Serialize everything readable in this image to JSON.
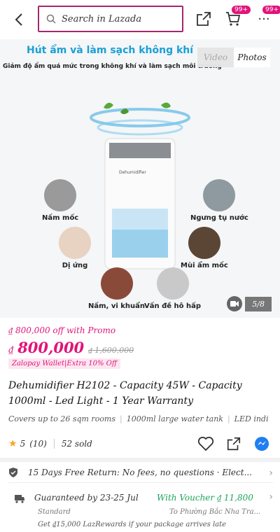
{
  "header": {
    "search_placeholder": "Search in Lazada",
    "cart_badge": "99+",
    "more_badge": "99+"
  },
  "gallery": {
    "banner_title": "Hút ẩm và làm sạch không khí",
    "banner_subtitle": "Giảm độ ẩm quá mức trong không khí và làm sạch môi trường",
    "media_tabs": [
      "Video",
      "Photos"
    ],
    "active_tab": "Photos",
    "features": [
      {
        "label": "Nấm mốc",
        "color": "#9a9a9a"
      },
      {
        "label": "Ngưng tụ nước",
        "color": "#8f9aa0"
      },
      {
        "label": "Dị ứng",
        "color": "#e8d2c2"
      },
      {
        "label": "Mùi ẩm mốc",
        "color": "#5b4636"
      },
      {
        "label": "Nấm, vi khuẩn",
        "color": "#8a4a3a"
      },
      {
        "label": "Vấn đề hô hấp",
        "color": "#c9c9c9"
      }
    ],
    "image_counter": "5/8"
  },
  "pricing": {
    "promo_text": "₫ 800,000 off with Promo",
    "currency": "₫",
    "price": "800,000",
    "original_price": "₫ 1,600,000",
    "wallet_tag": "Zalopay Wallet|Extra 10% Off"
  },
  "product": {
    "title": "Dehumidifier H2102 - Capacity 45W - Capacity 1000ml - Led Light - 1 Year Warranty",
    "specs": [
      "Covers up to 26 sqm rooms",
      "1000ml large water tank",
      "LED indi"
    ],
    "rating": "5",
    "review_count": "(10)",
    "sold": "52 sold"
  },
  "service": {
    "return_text": "15 Days Free Return: No fees, no questions · Elect..."
  },
  "delivery": {
    "guarantee": "Guaranteed by 23-25 Jul",
    "voucher": "With Voucher ₫ 11,800",
    "method": "Standard",
    "address": "To Phường Bắc Nha Tra...",
    "reward": "Get ₫15,000 LazRewards if your package arrives late"
  },
  "colors": {
    "brand_pink": "#e1147a",
    "search_border": "#a3286d",
    "voucher_green": "#1aa45a",
    "banner_blue": "#1a9fd6"
  }
}
